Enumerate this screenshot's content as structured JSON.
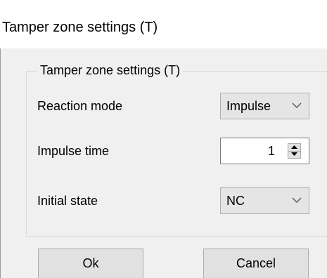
{
  "window": {
    "title": "Tamper zone settings (T)"
  },
  "group": {
    "legend": "Tamper zone settings (T)"
  },
  "fields": {
    "reaction_mode": {
      "label": "Reaction mode",
      "value": "Impulse"
    },
    "impulse_time": {
      "label": "Impulse time",
      "value": "1"
    },
    "initial_state": {
      "label": "Initial state",
      "value": "NC"
    }
  },
  "buttons": {
    "ok": "Ok",
    "cancel": "Cancel"
  },
  "icons": {
    "dropdown": "chevron-down-icon",
    "spin_up": "spin-up-icon",
    "spin_down": "spin-down-icon"
  }
}
